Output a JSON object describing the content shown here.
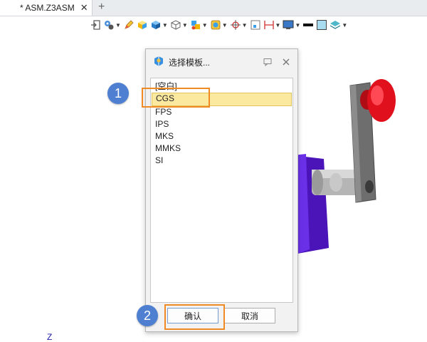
{
  "tab": {
    "title": "* ASM.Z3ASM",
    "close": "✕",
    "add": "+"
  },
  "dialog": {
    "title": "选择模板...",
    "items": [
      "[空白]",
      "CGS",
      "FPS",
      "IPS",
      "MKS",
      "MMKS",
      "SI"
    ],
    "selected_index": 1,
    "ok_label": "确认",
    "cancel_label": "取消"
  },
  "annotations": {
    "step1": "1",
    "step2": "2"
  },
  "viewport": {
    "axis_mark": "Z"
  },
  "colors": {
    "highlight": "#f08a24",
    "step_badge": "#4f7fd1",
    "selection": "#fce9a0",
    "part_purple": "#5a1fd6",
    "knob_red": "#e0101c"
  }
}
